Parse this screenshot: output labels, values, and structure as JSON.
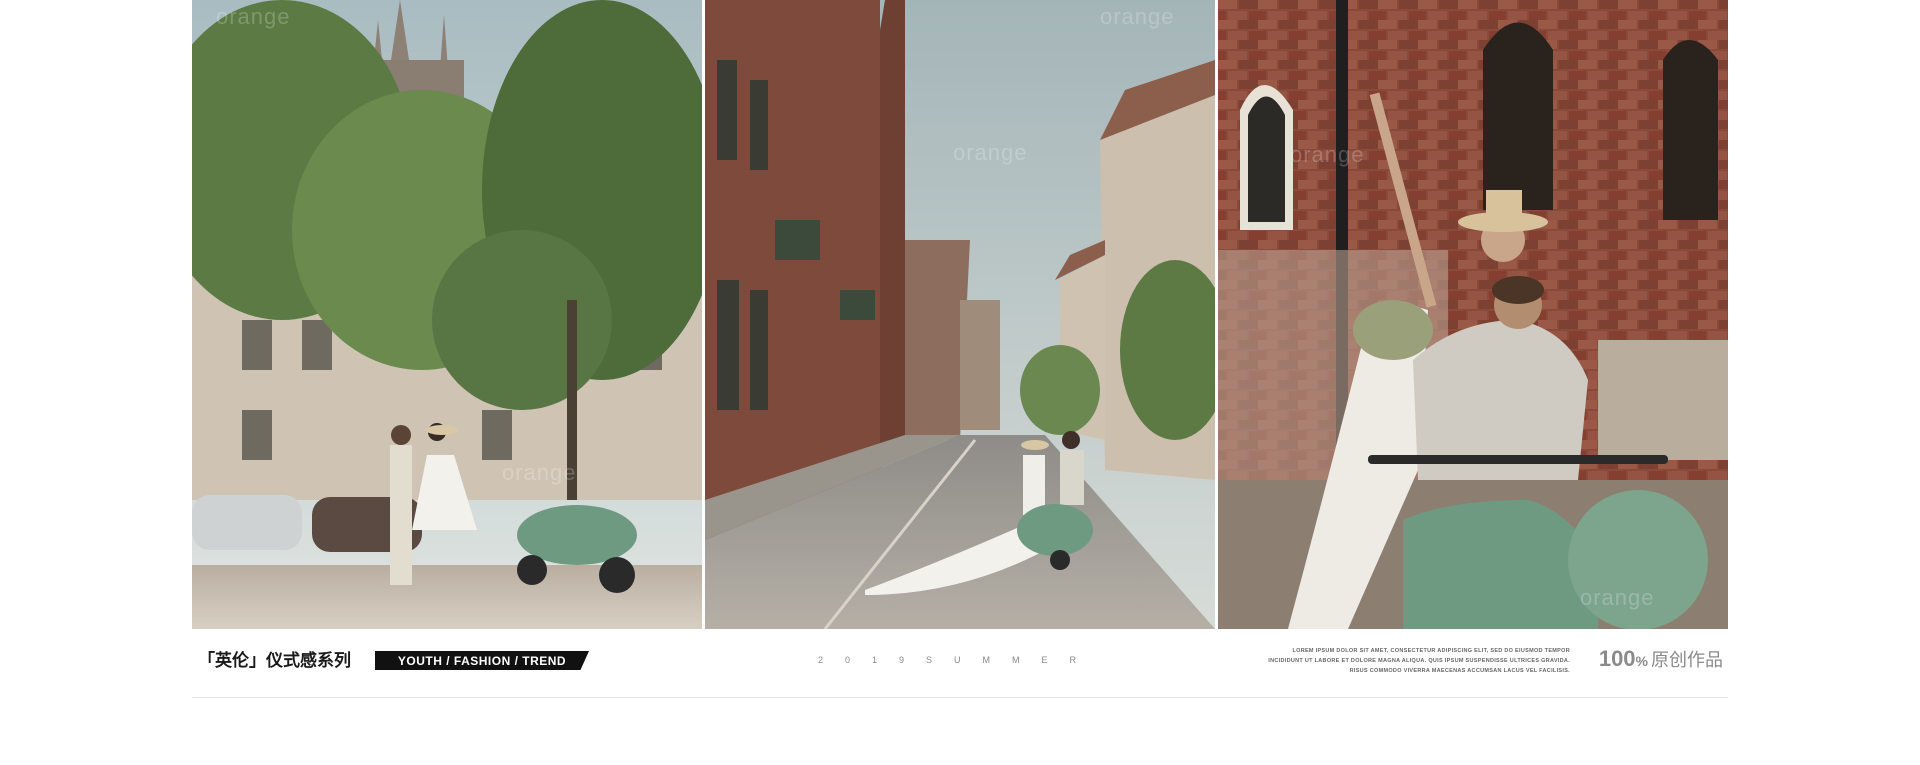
{
  "gallery": {
    "watermark": "orange",
    "photos": [
      {
        "name": "couple-with-scooter-under-trees"
      },
      {
        "name": "couple-riding-scooter-down-street"
      },
      {
        "name": "couple-on-scooter-brick-wall"
      }
    ]
  },
  "footer": {
    "title": "「英伦」仪式感系列",
    "tagline": "YOUTH  /  FASHION  /  TREND",
    "season": "2019SUMMER",
    "lorem_lines": [
      "LOREM IPSUM DOLOR SIT AMET, CONSECTETUR ADIPISCING ELIT, SED DO EIUSMOD TEMPOR",
      "INCIDIDUNT UT LABORE ET DOLORE MAGNA ALIQUA. QUIS IPSUM SUSPENDISSE ULTRICES GRAVIDA.",
      "RISUS COMMODO VIVERRA MAECENAS ACCUMSAN LACUS VEL FACILISIS."
    ],
    "badge_number": "100",
    "badge_percent": "%",
    "badge_text": "原创作品"
  },
  "colors": {
    "background": "#ffffff",
    "tag_bar": "#111111",
    "brick": "#8a4a3a",
    "scooter_green": "#6f9a82",
    "foliage": "#5f7a45",
    "sky": "#c9d3d4"
  }
}
